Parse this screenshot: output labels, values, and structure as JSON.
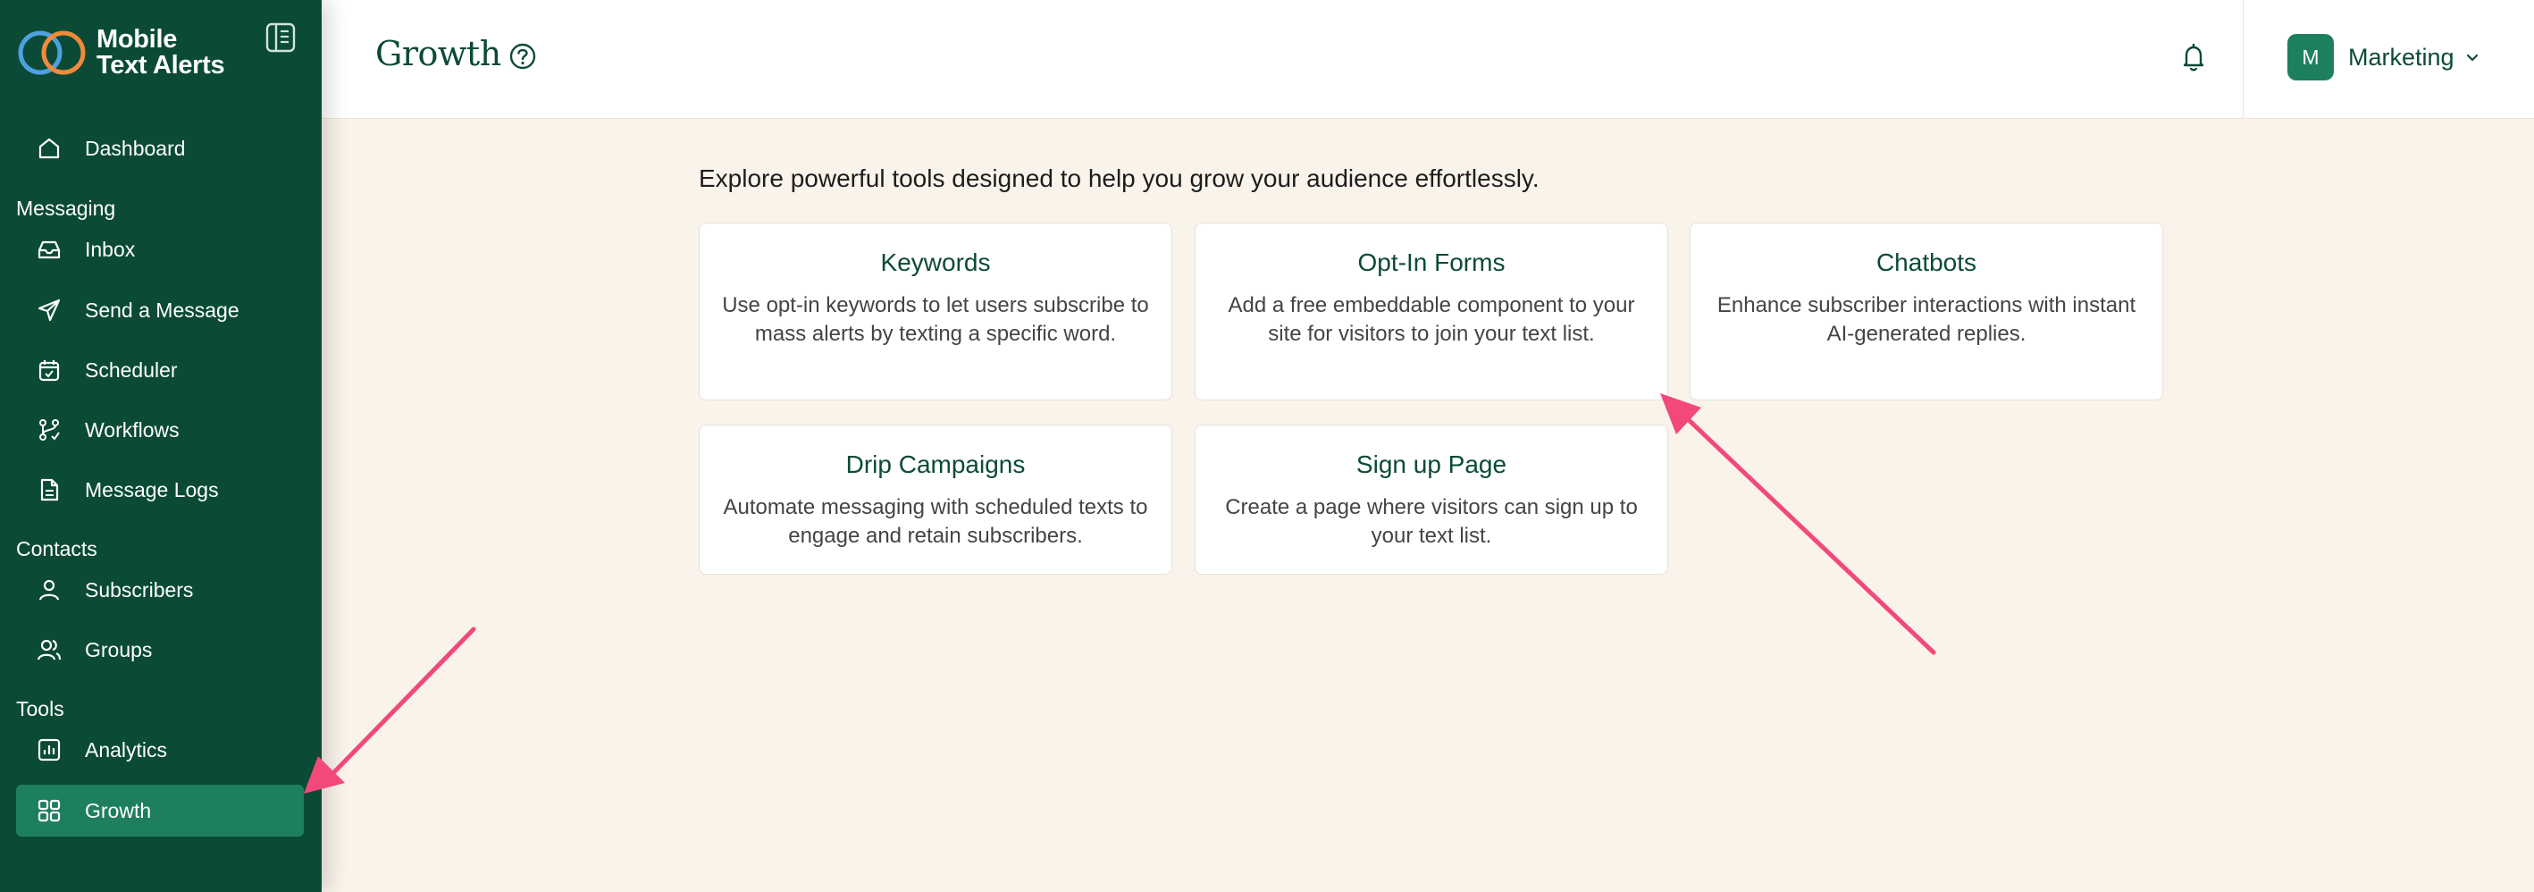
{
  "brand": {
    "name_line1": "Mobile",
    "name_line2": "Text Alerts"
  },
  "sidebar": {
    "dashboard": "Dashboard",
    "sections": {
      "messaging": "Messaging",
      "contacts": "Contacts",
      "tools": "Tools"
    },
    "items": [
      {
        "label": "Inbox",
        "icon": "inbox-icon"
      },
      {
        "label": "Send a Message",
        "icon": "send-icon"
      },
      {
        "label": "Scheduler",
        "icon": "calendar-icon"
      },
      {
        "label": "Workflows",
        "icon": "workflow-icon"
      },
      {
        "label": "Message Logs",
        "icon": "document-icon"
      },
      {
        "label": "Subscribers",
        "icon": "user-icon"
      },
      {
        "label": "Groups",
        "icon": "users-icon"
      },
      {
        "label": "Analytics",
        "icon": "chart-icon"
      },
      {
        "label": "Growth",
        "icon": "grid-icon",
        "active": true
      }
    ]
  },
  "header": {
    "title": "Growth",
    "account": {
      "initial": "M",
      "name": "Marketing"
    }
  },
  "main": {
    "intro": "Explore powerful tools designed to help you grow your audience effortlessly.",
    "cards": [
      {
        "title": "Keywords",
        "description": "Use opt-in keywords to let users subscribe to mass alerts by texting a specific word."
      },
      {
        "title": "Opt-In Forms",
        "description": "Add a free embeddable component to your site for visitors to join your text list."
      },
      {
        "title": "Chatbots",
        "description": "Enhance subscriber interactions with instant AI-generated replies."
      },
      {
        "title": "Drip Campaigns",
        "description": "Automate messaging with scheduled texts to engage and retain subscribers."
      },
      {
        "title": "Sign up Page",
        "description": "Create a page where visitors can sign up to your text list."
      }
    ]
  },
  "colors": {
    "sidebar_bg": "#0b4a37",
    "active_item": "#1e7f5c",
    "page_bg": "#faf3ea",
    "annotation_arrow": "#f2487a"
  }
}
